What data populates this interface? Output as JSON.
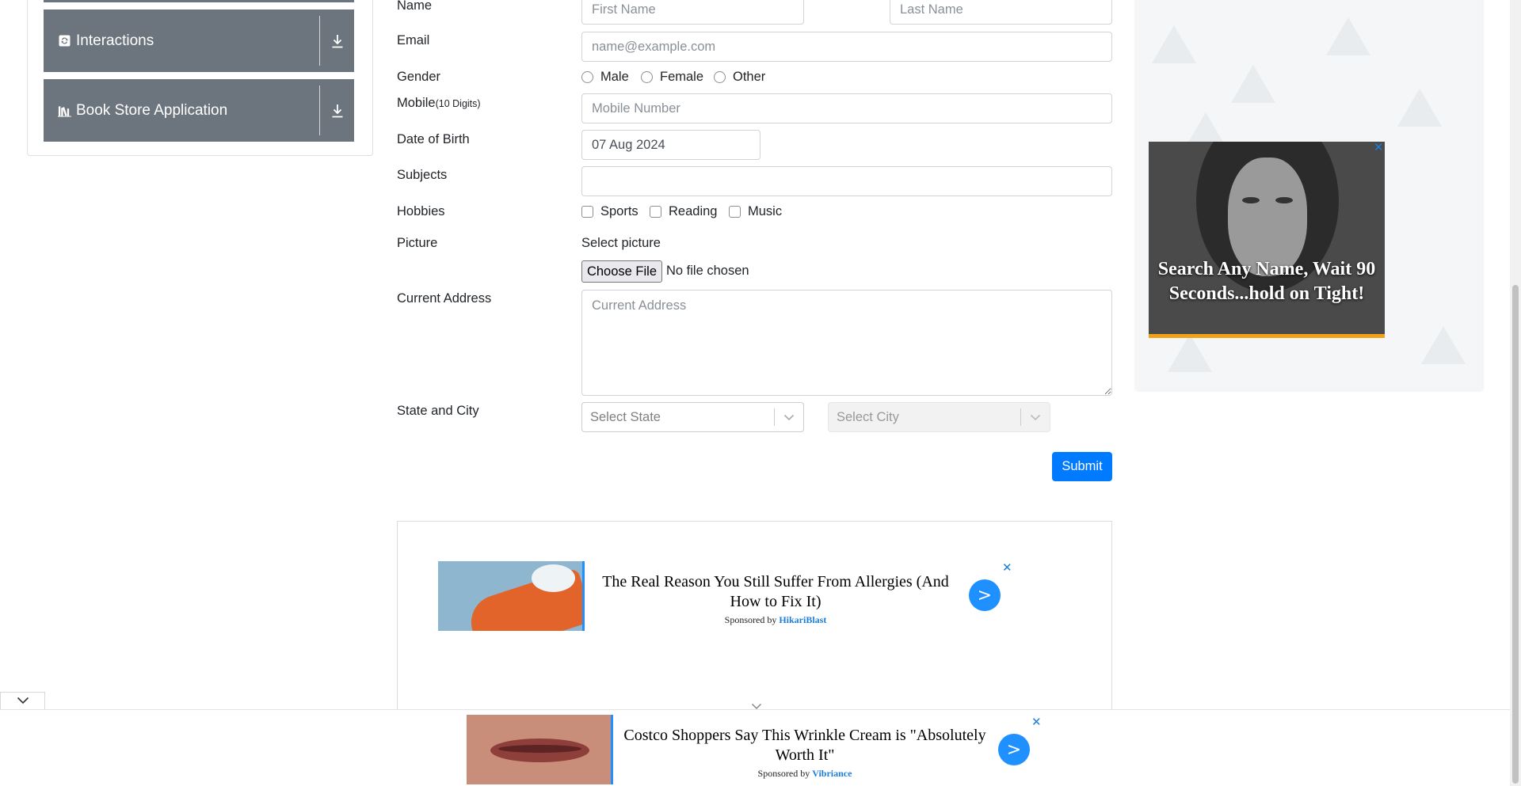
{
  "sidebar": {
    "groups": [
      {
        "label": "Interactions",
        "icon": "interactions-icon"
      },
      {
        "label": "Book Store Application",
        "icon": "book-store-icon"
      }
    ],
    "download_icon": "download-icon"
  },
  "form": {
    "name_label": "Name",
    "first_name_placeholder": "First Name",
    "last_name_placeholder": "Last Name",
    "email_label": "Email",
    "email_placeholder": "name@example.com",
    "gender_label": "Gender",
    "gender_options": [
      "Male",
      "Female",
      "Other"
    ],
    "mobile_label": "Mobile",
    "mobile_hint": "(10 Digits)",
    "mobile_placeholder": "Mobile Number",
    "dob_label": "Date of Birth",
    "dob_value": "07 Aug 2024",
    "subjects_label": "Subjects",
    "subjects_value": "",
    "hobbies_label": "Hobbies",
    "hobby_options": [
      "Sports",
      "Reading",
      "Music"
    ],
    "picture_label": "Picture",
    "select_picture_text": "Select picture",
    "choose_file_label": "Choose File",
    "no_file_text": "No file chosen",
    "address_label": "Current Address",
    "address_placeholder": "Current Address",
    "state_city_label": "State and City",
    "state_placeholder": "Select State",
    "city_placeholder": "Select City",
    "submit_label": "Submit"
  },
  "ads": {
    "inline": {
      "headline": "The Real Reason You Still Suffer From Allergies (And How to Fix It)",
      "sponsored_by": "Sponsored by",
      "sponsor": "HikariBlast",
      "go_label": ">",
      "close_label": "✕"
    },
    "right": {
      "headline": "Search Any Name, Wait 90 Seconds...hold on Tight!",
      "close_label": "✕",
      "accent_color": "#f0a21a"
    },
    "bottom": {
      "headline": "Costco Shoppers Say This Wrinkle Cream is \"Absolutely Worth It\"",
      "sponsored_by": "Sponsored by",
      "sponsor": "Vibriance",
      "go_label": ">",
      "close_label": "✕"
    }
  },
  "colors": {
    "sidebar_group_bg": "#6c757d",
    "primary": "#007bff",
    "ad_link": "#1a7fdc"
  }
}
